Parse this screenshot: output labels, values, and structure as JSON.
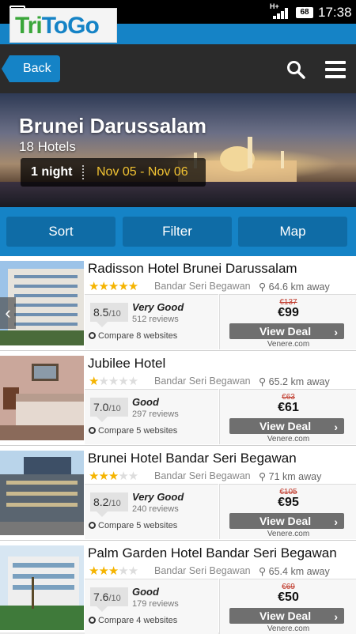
{
  "status": {
    "network": "H+",
    "battery": "68",
    "time": "17:38"
  },
  "brand": {
    "logo_part1": "Tri",
    "logo_part2": "ToGo"
  },
  "nav": {
    "back_label": "Back"
  },
  "hero": {
    "title": "Brunei Darussalam",
    "hotel_count": "18 Hotels",
    "nights": "1 night",
    "dates": "Nov 05 - Nov 06"
  },
  "toolbar": {
    "sort": "Sort",
    "filter": "Filter",
    "map": "Map"
  },
  "colors": {
    "accent": "#1583c6",
    "star": "#f5b400",
    "old_price": "#c0392b"
  },
  "hotels": [
    {
      "name": "Radisson Hotel Brunei Darussalam",
      "stars": 5,
      "location": "Bandar Seri Begawan",
      "distance": "64.6 km away",
      "score": "8.5",
      "score_max": "/10",
      "rating": "Very Good",
      "reviews": "512 reviews",
      "compare": "Compare 8 websites",
      "old_price": "€137",
      "price": "€99",
      "deal_label": "View Deal",
      "site": "Venere.com"
    },
    {
      "name": "Jubilee Hotel",
      "stars": 1,
      "location": "Bandar Seri Begawan",
      "distance": "65.2 km away",
      "score": "7.0",
      "score_max": "/10",
      "rating": "Good",
      "reviews": "297 reviews",
      "compare": "Compare 5 websites",
      "old_price": "€63",
      "price": "€61",
      "deal_label": "View Deal",
      "site": "Venere.com"
    },
    {
      "name": "Brunei Hotel Bandar Seri Begawan",
      "stars": 3,
      "location": "Bandar Seri Begawan",
      "distance": "71 km away",
      "score": "8.2",
      "score_max": "/10",
      "rating": "Very Good",
      "reviews": "240 reviews",
      "compare": "Compare 5 websites",
      "old_price": "€105",
      "price": "€95",
      "deal_label": "View Deal",
      "site": "Venere.com"
    },
    {
      "name": "Palm Garden Hotel Bandar Seri Begawan",
      "stars": 3,
      "location": "Bandar Seri Begawan",
      "distance": "65.4 km away",
      "score": "7.6",
      "score_max": "/10",
      "rating": "Good",
      "reviews": "179 reviews",
      "compare": "Compare 4 websites",
      "old_price": "€69",
      "price": "€50",
      "deal_label": "View Deal",
      "site": "Venere.com"
    }
  ]
}
